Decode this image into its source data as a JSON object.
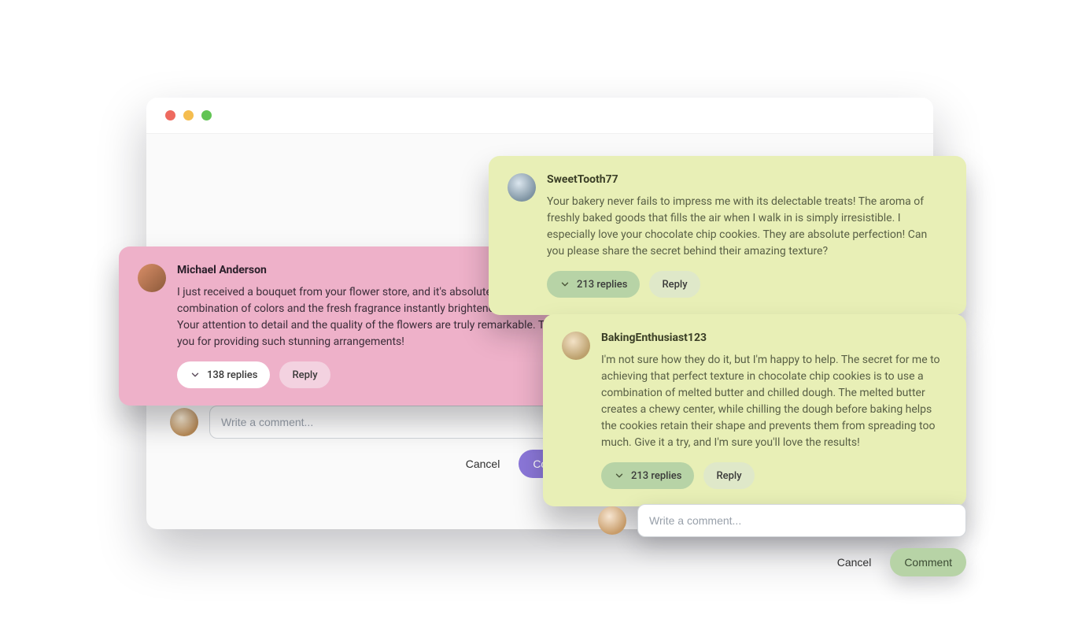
{
  "colors": {
    "pink_card": "#eeb1c9",
    "yellow_card": "#e8efb6",
    "green_pill": "#b7d3a6",
    "purple_button": "#8b77d9"
  },
  "cards": {
    "pink": {
      "username": "Michael Anderson",
      "text": "I just received a bouquet from your flower store, and it's absolutely stunning! The combination of colors and the fresh fragrance instantly brightened up my day. Your attention to detail and the quality of the flowers are truly remarkable. Thank you for providing such stunning arrangements!",
      "replies_label": "138 replies",
      "reply_label": "Reply"
    },
    "yellow1": {
      "username": "SweetTooth77",
      "text": "Your bakery never fails to impress me with its delectable treats! The aroma of freshly baked goods that fills the air when I walk in is simply irresistible. I especially love your chocolate chip cookies. They are absolute perfection! Can you please share the secret behind their amazing texture?",
      "replies_label": "213 replies",
      "reply_label": "Reply"
    },
    "yellow2": {
      "username": "BakingEnthusiast123",
      "text": "I'm not sure how they do it, but I'm happy to help. The secret for me to achieving that perfect texture in chocolate chip cookies is to use a combination of melted butter and chilled dough. The melted butter creates a chewy center, while chilling the dough before baking helps the cookies retain their shape and prevents them from spreading too much. Give it a try, and I'm sure you'll love the results!",
      "replies_label": "213 replies",
      "reply_label": "Reply"
    }
  },
  "composers": {
    "left": {
      "placeholder": "Write a comment...",
      "cancel_label": "Cancel",
      "comment_label": "Comment"
    },
    "right": {
      "placeholder": "Write a comment...",
      "cancel_label": "Cancel",
      "comment_label": "Comment"
    }
  }
}
